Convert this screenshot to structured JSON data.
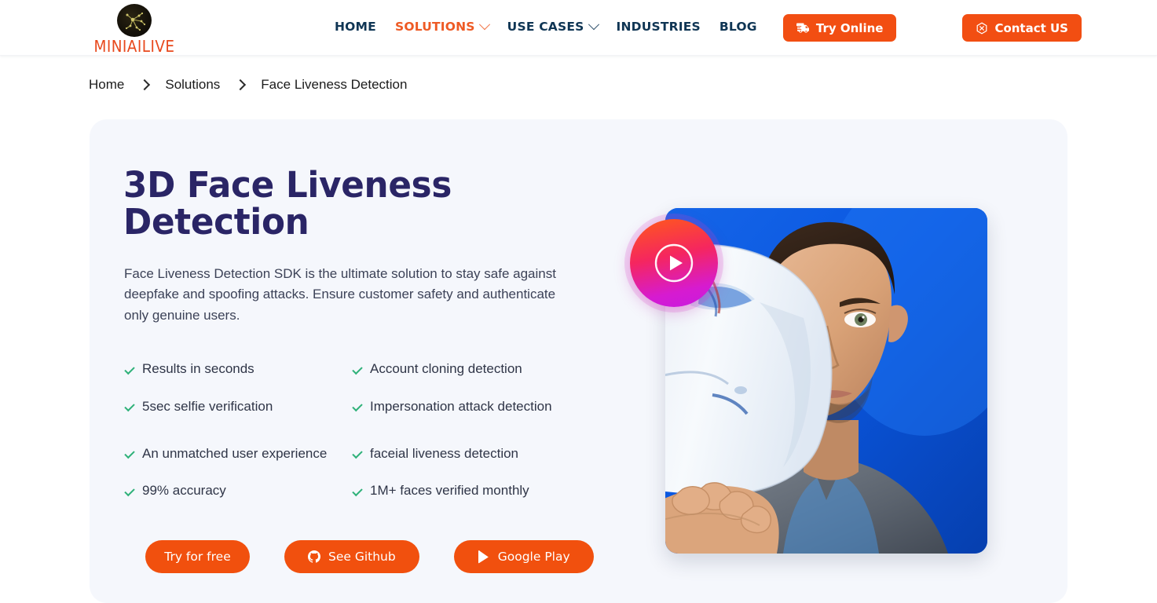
{
  "header": {
    "brand": {
      "name": "MINIAILIVE",
      "logo_icon": "neural-network-circle-icon"
    },
    "nav": [
      {
        "label": "HOME",
        "has_caret": false,
        "active": false
      },
      {
        "label": "SOLUTIONS",
        "has_caret": true,
        "active": true
      },
      {
        "label": "USE CASES",
        "has_caret": true,
        "active": false
      },
      {
        "label": "INDUSTRIES",
        "has_caret": false,
        "active": false
      },
      {
        "label": "BLOG",
        "has_caret": false,
        "active": false
      }
    ],
    "actions": {
      "try_online": {
        "label": "Try Online",
        "icon": "truck-icon"
      },
      "contact_us": {
        "label": "Contact US",
        "icon": "hexagon-icon"
      }
    }
  },
  "breadcrumb": {
    "items": [
      {
        "label": "Home"
      },
      {
        "label": "Solutions"
      },
      {
        "label": "Face Liveness Detection"
      }
    ],
    "separator_icon": "chevron-right-icon"
  },
  "hero": {
    "title": "3D Face Liveness Detection",
    "subtitle": "Face Liveness Detection SDK is the ultimate solution to stay safe against deepfake and spoofing attacks. Ensure customer safety and authenticate only genuine users.",
    "features": [
      {
        "label": "Results in seconds",
        "two_line": false
      },
      {
        "label": "Account cloning detection",
        "two_line": false
      },
      {
        "label": "5sec selfie verification",
        "two_line": false
      },
      {
        "label": "Impersonation attack detection",
        "two_line": true
      },
      {
        "label": "An unmatched user experience",
        "two_line": true
      },
      {
        "label": "faceial liveness detection",
        "two_line": false
      },
      {
        "label": "99% accuracy",
        "two_line": false
      },
      {
        "label": "1M+ faces verified monthly",
        "two_line": false
      }
    ],
    "buttons": [
      {
        "label": "Try for free",
        "icon": null
      },
      {
        "label": "See Github",
        "icon": "github-icon"
      },
      {
        "label": "Google Play",
        "icon": "google-play-icon"
      }
    ],
    "media": {
      "play_button_icon": "play-circle-icon",
      "photo_alt": "man holding white face mask over half of his face on blue background"
    }
  },
  "colors": {
    "brand_orange": "#f24e12",
    "cta_orange": "#f1500e",
    "nav_dark": "#0f3554",
    "nav_active": "#ee5a24",
    "title_indigo": "#2a2566",
    "check_green": "#2fb179",
    "card_bg": "#f5f7fc",
    "page_bg": "#ffffff"
  }
}
